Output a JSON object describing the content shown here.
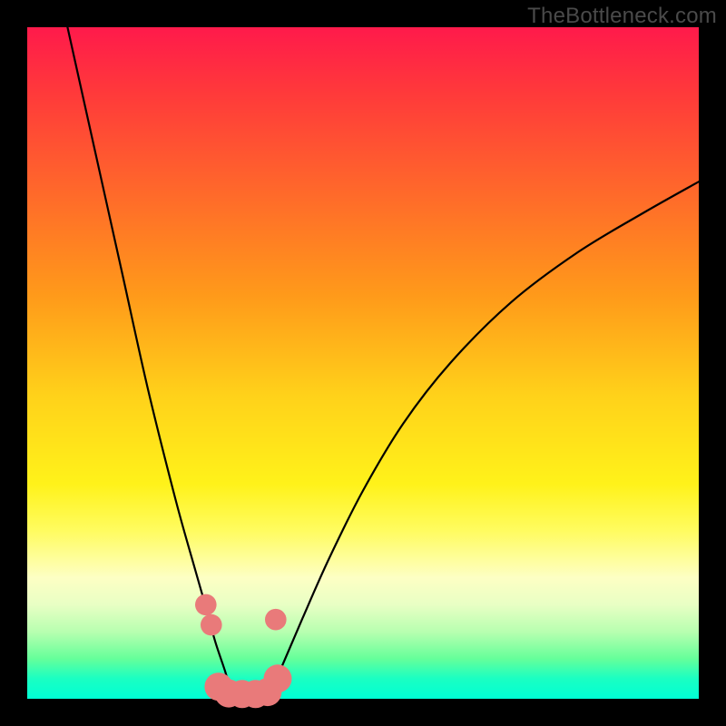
{
  "watermark": "TheBottleneck.com",
  "colors": {
    "background_frame": "#000000",
    "curve": "#000000",
    "marker_fill": "#e97a7a",
    "marker_stroke": "#c85a5a",
    "gradient_top": "#ff1a4b",
    "gradient_bottom": "#00ffd5"
  },
  "chart_data": {
    "type": "line",
    "title": "",
    "xlabel": "",
    "ylabel": "",
    "xlim": [
      0,
      100
    ],
    "ylim": [
      0,
      100
    ],
    "grid": false,
    "legend": false,
    "note": "Values are percentage positions within the 740×740 plot area (0,0 = top-left). Two curve segments meet at the bottom near x≈30–36. Markers cluster at the valley.",
    "series": [
      {
        "name": "left-branch",
        "x": [
          6.0,
          10.0,
          14.0,
          18.0,
          22.0,
          24.5,
          26.5,
          28.0,
          29.5,
          30.5
        ],
        "y": [
          0.0,
          18.0,
          36.0,
          54.0,
          70.0,
          79.0,
          86.0,
          91.5,
          96.0,
          99.5
        ]
      },
      {
        "name": "right-branch",
        "x": [
          36.0,
          38.0,
          41.0,
          45.0,
          50.0,
          56.0,
          63.0,
          72.0,
          82.0,
          92.0,
          100.0
        ],
        "y": [
          99.5,
          95.0,
          88.0,
          79.0,
          69.0,
          59.0,
          50.0,
          41.0,
          33.5,
          27.5,
          23.0
        ]
      }
    ],
    "markers": [
      {
        "x": 26.6,
        "y": 86.0,
        "r": 1.6
      },
      {
        "x": 27.4,
        "y": 89.0,
        "r": 1.6
      },
      {
        "x": 28.5,
        "y": 98.2,
        "r": 2.1
      },
      {
        "x": 30.0,
        "y": 99.2,
        "r": 2.1
      },
      {
        "x": 32.0,
        "y": 99.3,
        "r": 2.1
      },
      {
        "x": 34.0,
        "y": 99.3,
        "r": 2.1
      },
      {
        "x": 35.8,
        "y": 99.0,
        "r": 2.1
      },
      {
        "x": 37.3,
        "y": 97.0,
        "r": 2.1
      },
      {
        "x": 37.0,
        "y": 88.2,
        "r": 1.6
      }
    ]
  }
}
